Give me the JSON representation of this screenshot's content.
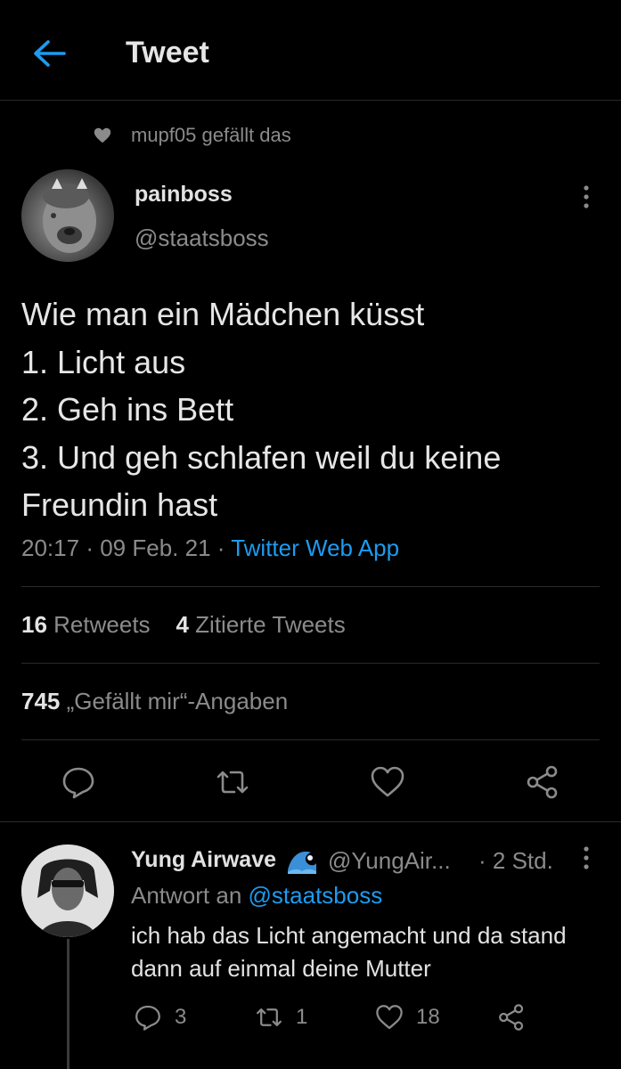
{
  "header": {
    "title": "Tweet",
    "back_icon": "arrow-left-icon",
    "accent": "#1d9bf0"
  },
  "social_context": {
    "icon": "heart-icon",
    "text": "mupf05 gefällt das"
  },
  "tweet": {
    "author": {
      "display_name": "painboss",
      "handle": "@staatsboss"
    },
    "text": "Wie man ein Mädchen küsst\n 1. Licht aus\n 2. Geh ins Bett\n 3. Und geh schlafen weil du keine Freundin hast",
    "time": "20:17",
    "sep": "·",
    "date": "09 Feb. 21",
    "source": "Twitter Web App",
    "retweets_count": "16",
    "retweets_label": "Retweets",
    "quotes_count": "4",
    "quotes_label": "Zitierte Tweets",
    "likes_count": "745",
    "likes_label": "„Gefällt mir“-Angaben"
  },
  "reply": {
    "display_name": "Yung Airwave",
    "emoji_icon": "water-wave-icon",
    "handle": "@YungAir...",
    "time": "· 2 Std.",
    "reply_to_prefix": "Antwort an",
    "reply_to_handle": "@staatsboss",
    "text": "ich hab das Licht angemacht und da stand dann auf einmal deine Mutter",
    "replies": "3",
    "retweets": "1",
    "likes": "18"
  }
}
